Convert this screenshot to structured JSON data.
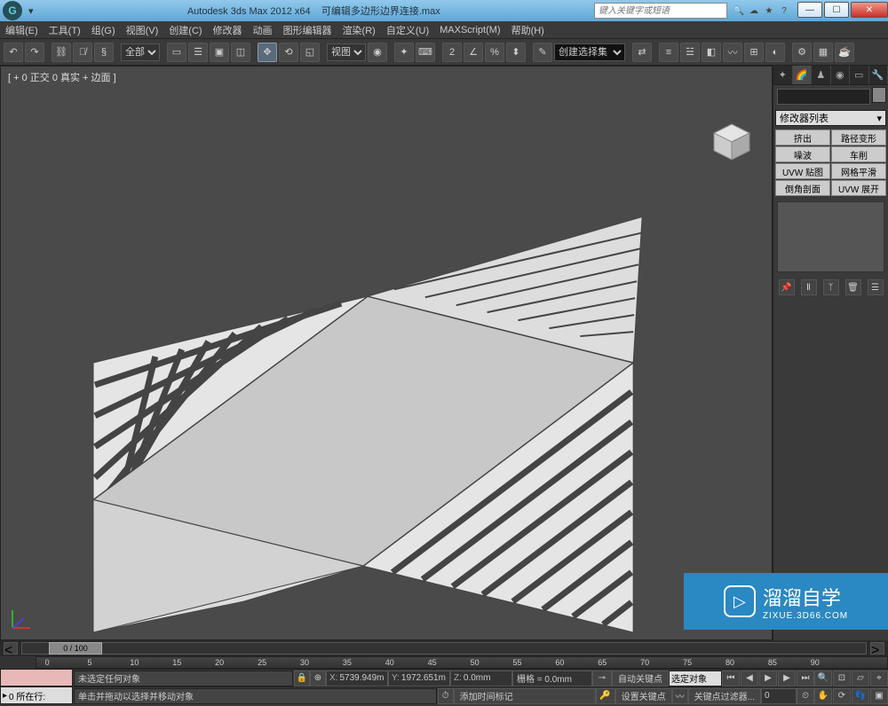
{
  "title": {
    "app": "Autodesk 3ds Max  2012 x64",
    "file": "可编辑多边形边界连接.max",
    "search_placeholder": "键入关键字或短语"
  },
  "menu": {
    "edit": "编辑(E)",
    "tools": "工具(T)",
    "group": "组(G)",
    "views": "视图(V)",
    "create": "创建(C)",
    "modifiers": "修改器",
    "animation": "动画",
    "graph": "图形编辑器",
    "rendering": "渲染(R)",
    "customize": "自定义(U)",
    "maxscript": "MAXScript(M)",
    "help": "帮助(H)"
  },
  "toolbar": {
    "filter_all": "全部",
    "view_label": "视图",
    "selset_label": "创建选择集"
  },
  "viewport": {
    "label": "[ + 0 正交 0 真实 + 边面 ]"
  },
  "cmd": {
    "modifier_list": "修改器列表",
    "buttons": [
      "挤出",
      "路径变形",
      "噪波",
      "车削",
      "UVW 贴图",
      "网格平滑",
      "倒角剖面",
      "UVW 展开"
    ]
  },
  "timeline": {
    "slider": "0 / 100",
    "ticks": [
      "0",
      "5",
      "10",
      "15",
      "20",
      "25",
      "30",
      "35",
      "40",
      "45",
      "50",
      "55",
      "60",
      "65",
      "70",
      "75",
      "80",
      "85",
      "90"
    ]
  },
  "status": {
    "prompt1": "未选定任何对象",
    "prompt2": "单击并拖动以选择并移动对象",
    "selset_label": "0 所在行:",
    "add_time_tag": "添加时间标记",
    "x": "5739.949m",
    "y": "1972.651m",
    "z": "0.0mm",
    "grid": "栅格 = 0.0mm",
    "autokey": "自动关键点",
    "setkey": "设置关键点",
    "selected": "选定对象",
    "keyfilter": "关键点过滤器..."
  },
  "watermark": {
    "text": "溜溜自学",
    "url": "ZIXUE.3D66.COM"
  }
}
